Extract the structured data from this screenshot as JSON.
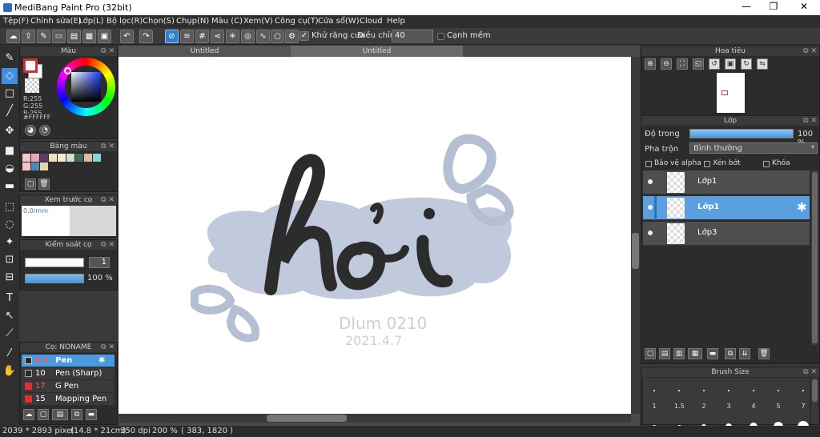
{
  "window": {
    "title": "MediBang Paint Pro (32bit)",
    "minimize": "—",
    "restore": "❐",
    "close": "✕"
  },
  "menu": [
    "Tệp(F)",
    "Chỉnh sửa(E)",
    "Lớp(L)",
    "Bộ lọc(R)",
    "Chọn(S)",
    "Chụp(N)",
    "Màu (C)",
    "Xem(V)",
    "Công cụ(T)",
    "Cửa sổ(W)",
    "Cloud",
    "Help"
  ],
  "toolbar": {
    "antialias_label": "Khử răng cưa",
    "adjust_label": "Điều chỉnh",
    "adjust_value": "40",
    "edge_label": "Cạnh mềm"
  },
  "color_panel": {
    "title": "Màu",
    "r": "R:255",
    "g": "G:255",
    "b": "B:255",
    "hex": "#FFFFFF",
    "primary": "#ffffff",
    "secondary": "#d03030"
  },
  "palette_panel": {
    "title": "Bảng màu",
    "colors": [
      "#f2c9c9",
      "#e7a8b6",
      "#5b3d66",
      "#f1e1b8",
      "#f6e6d8",
      "#c9e3c8",
      "#3c6b5e",
      "#d9c29a",
      "#8fd0d0",
      "#f4c4c4",
      "#4a8ab6",
      "#e6d3b0"
    ]
  },
  "brush_preview": {
    "title": "Xem trước cọ",
    "size": "0.0/mm"
  },
  "brush_control": {
    "title": "Kiểm soát cọ",
    "size_value": "1",
    "opacity_value": "100 %"
  },
  "brush_panel": {
    "title": "Cọ: NONAME",
    "items": [
      {
        "size": "4.1",
        "name": "Pen",
        "color": "#2a2a2a"
      },
      {
        "size": "10",
        "name": "Pen (Sharp)",
        "color": "#2a2a2a"
      },
      {
        "size": "17",
        "name": "G Pen",
        "color": "#e03030"
      },
      {
        "size": "15",
        "name": "Mapping Pen",
        "color": "#e03030"
      }
    ]
  },
  "tabs": [
    "Untitled",
    "Untitled"
  ],
  "artwork": {
    "word": "hỏi",
    "signature_line1": "Dlum 0210",
    "signature_line2": "2021.4.7"
  },
  "navigator": {
    "title": "Hoa tiêu"
  },
  "layers": {
    "title": "Lớp",
    "opacity_label": "Độ trong",
    "opacity_value": "100 %",
    "opacity_fraction": 1.0,
    "blend_label": "Pha trộn",
    "blend_value": "Bình thường",
    "protect_alpha": "Bảo vệ alpha",
    "clipping": "Xén bớt",
    "lock": "Khóa",
    "items": [
      "Lớp1",
      "Lớp1",
      "Lớp3"
    ]
  },
  "brush_size": {
    "title": "Brush Size",
    "sizes": [
      "1",
      "1.5",
      "2",
      "3",
      "4",
      "5",
      "7"
    ]
  },
  "status": {
    "dimensions": "2039 * 2893 pixel",
    "physical": "(14.8 * 21cm)",
    "dpi": "350 dpi",
    "zoom": "200 %",
    "coords": "( 383, 1820 )"
  }
}
